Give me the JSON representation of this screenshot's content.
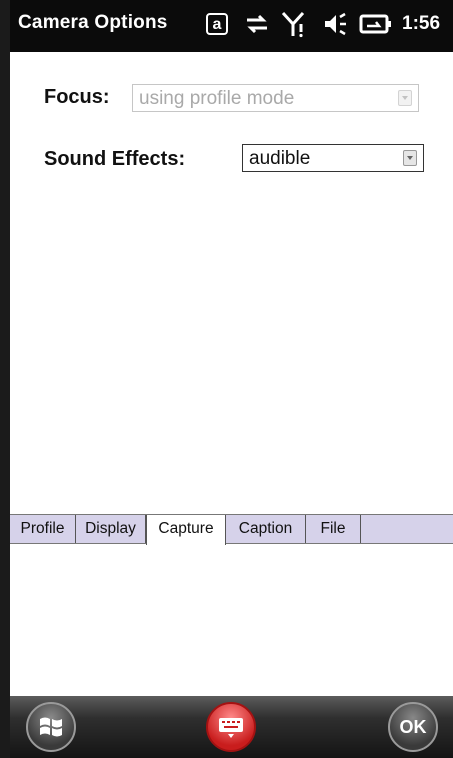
{
  "titlebar": {
    "title": "Camera Options",
    "time": "1:56",
    "status_icons": [
      "accessibility-a-icon",
      "sync-arrows-icon",
      "signal-icon",
      "volume-icon",
      "battery-icon"
    ],
    "a_glyph": "a"
  },
  "form": {
    "focus": {
      "label": "Focus:",
      "value": "using profile mode",
      "enabled": false
    },
    "sound_effects": {
      "label": "Sound Effects:",
      "value": "audible",
      "enabled": true
    }
  },
  "tabs": [
    {
      "label": "Profile",
      "active": false
    },
    {
      "label": "Display",
      "active": false
    },
    {
      "label": "Capture",
      "active": true
    },
    {
      "label": "Caption",
      "active": false
    },
    {
      "label": "File",
      "active": false
    }
  ],
  "bottombar": {
    "start_icon": "windows-logo-icon",
    "keyboard_icon": "keyboard-icon",
    "ok_label": "OK"
  },
  "colors": {
    "title_bg": "#0b0b0b",
    "tab_strip": "#d6d2ea",
    "keyboard_button": "#c91d1d",
    "disabled_text": "#a9a9a9"
  }
}
